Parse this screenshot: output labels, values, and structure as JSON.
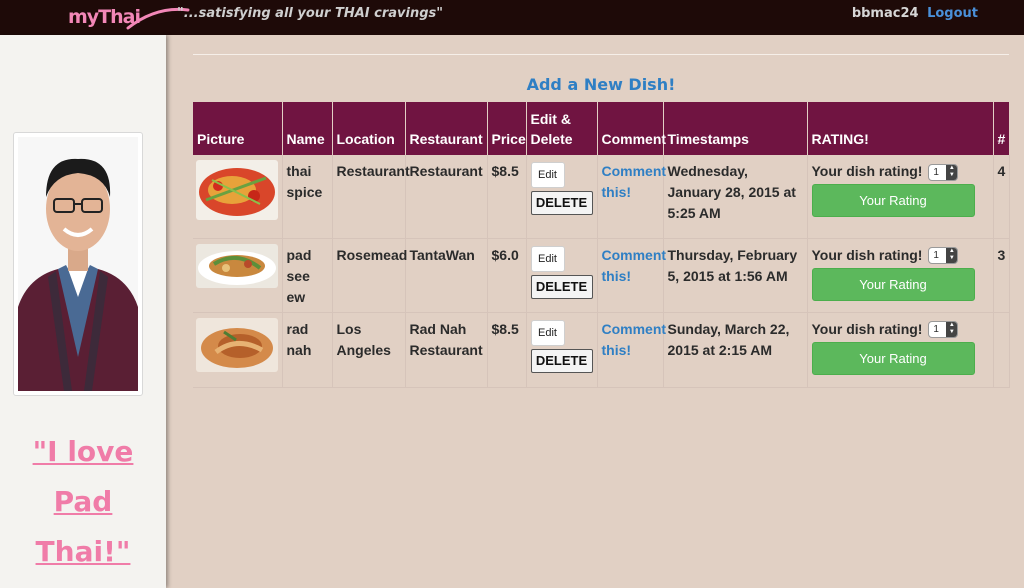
{
  "header": {
    "logo": "myThai",
    "tagline": "\"...satisfying all your THAI cravings\"",
    "username": "bbmac24",
    "logout_label": "Logout"
  },
  "sidebar": {
    "quote_lines": [
      "\"I love",
      "Pad",
      "Thai!\""
    ]
  },
  "main": {
    "add_dish_label": "Add a New Dish!",
    "columns": [
      "Picture",
      "Name",
      "Location",
      "Restaurant",
      "Price",
      "Edit & Delete",
      "Comment",
      "Timestamps",
      "RATING!",
      "#"
    ],
    "rows": [
      {
        "name": "thai spice",
        "location": "Restaurant",
        "restaurant": "Restaurant",
        "price": "$8.5",
        "edit_label": "Edit",
        "delete_label": "DELETE",
        "comment_label": "Comment this!",
        "timestamp": "Wednesday, January 28, 2015 at 5:25 AM",
        "rating_prompt": "Your dish rating!",
        "rating_value": "1",
        "rating_button": "Your Rating",
        "count": "4"
      },
      {
        "name": "pad see ew",
        "location": "Rosemead",
        "restaurant": "TantaWan",
        "price": "$6.0",
        "edit_label": "Edit",
        "delete_label": "DELETE",
        "comment_label": "Comment this!",
        "timestamp": "Thursday, February 5, 2015 at 1:56 AM",
        "rating_prompt": "Your dish rating!",
        "rating_value": "1",
        "rating_button": "Your Rating",
        "count": "3"
      },
      {
        "name": "rad nah",
        "location": "Los Angeles",
        "restaurant": "Rad Nah Restaurant",
        "price": "$8.5",
        "edit_label": "Edit",
        "delete_label": "DELETE",
        "comment_label": "Comment this!",
        "timestamp": "Sunday, March 22, 2015 at 2:15 AM",
        "rating_prompt": "Your dish rating!",
        "rating_value": "1",
        "rating_button": "Your Rating",
        "count": ""
      }
    ]
  },
  "colors": {
    "topbar": "#1e0a08",
    "background": "#e1d0c4",
    "table_header": "#701441",
    "link": "#2f7fc4",
    "rating_button": "#5cb85c",
    "quote": "#f07ca8",
    "logo": "#f287b7"
  }
}
